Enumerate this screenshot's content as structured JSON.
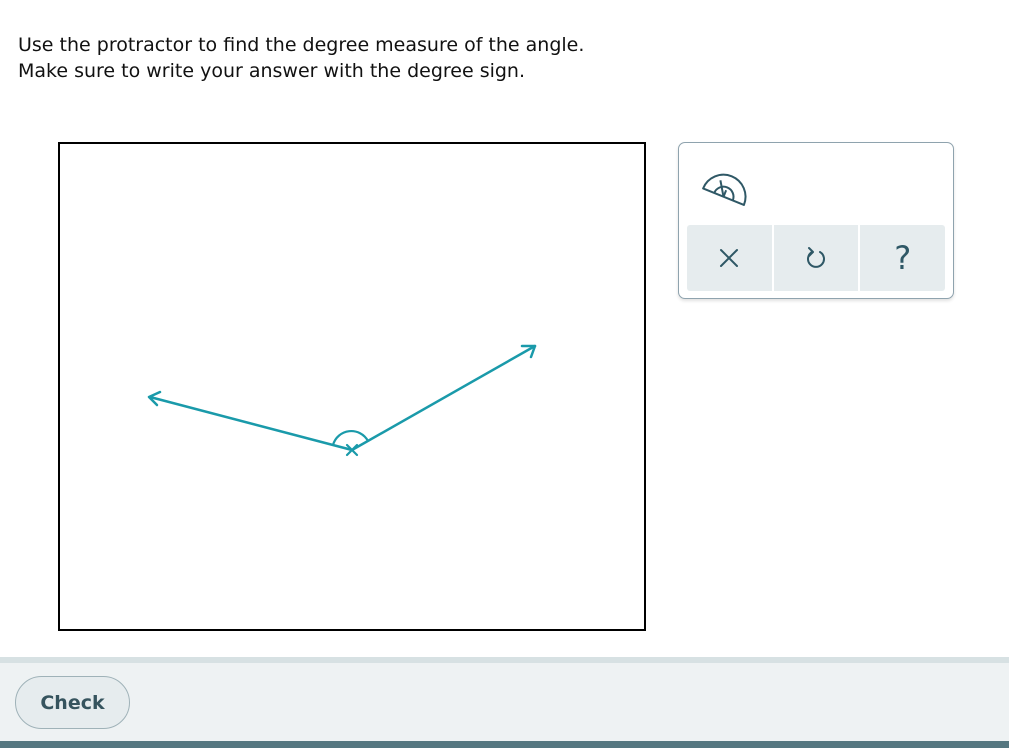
{
  "prompt": {
    "line1": "Use the protractor to find the degree measure of the angle.",
    "line2": "Make sure to write your answer with the degree sign."
  },
  "colors": {
    "ray_color": "#1a9aaa",
    "panel_icon_color": "#2f5866",
    "check_text_color": "#36545e"
  },
  "tools": {
    "protractor_icon": "protractor-icon",
    "buttons": [
      {
        "name": "clear-button",
        "icon": "close-icon"
      },
      {
        "name": "undo-button",
        "icon": "undo-icon"
      },
      {
        "name": "help-button",
        "icon": "question-icon",
        "glyph": "?"
      }
    ]
  },
  "footer": {
    "check_label": "Check"
  }
}
